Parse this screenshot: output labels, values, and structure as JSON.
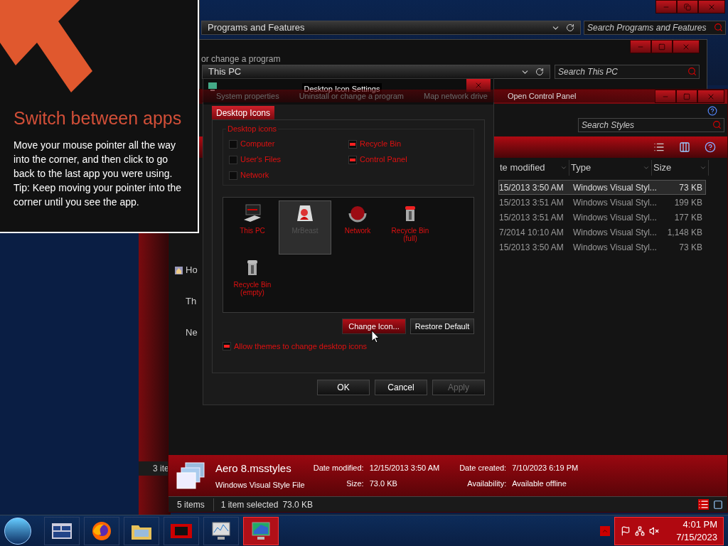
{
  "tip": {
    "title": "Switch between apps",
    "body": "Move your mouse pointer all the way into the corner, and then click to go back to the last app you were using.",
    "hint": "Tip: Keep moving your pointer into the corner until you see the app."
  },
  "programs_window": {
    "address": "Programs and Features",
    "search_placeholder": "Search Programs and Features"
  },
  "this_pc_window": {
    "heading_fragment": "or change a program",
    "address": "This PC",
    "search_placeholder": "Search This PC",
    "toolbar": [
      "System properties",
      "Uninstall or change a program",
      "Map network drive",
      "Open Control Panel"
    ]
  },
  "back_window": {
    "status_fragment": "3 ite"
  },
  "styles_window": {
    "search_placeholder": "Search Styles",
    "nav_fragments": [
      {
        "kind": "home",
        "label": "Ho"
      },
      {
        "kind": "none",
        "label": "Th"
      },
      {
        "kind": "none",
        "label": "Ne"
      }
    ],
    "columns": [
      "te modified",
      "Type",
      "Size"
    ],
    "rows": [
      {
        "date": "15/2013 3:50 AM",
        "type": "Windows Visual Styl...",
        "size": "73 KB",
        "selected": true
      },
      {
        "date": "15/2013 3:51 AM",
        "type": "Windows Visual Styl...",
        "size": "199 KB",
        "selected": false
      },
      {
        "date": "15/2013 3:51 AM",
        "type": "Windows Visual Styl...",
        "size": "177 KB",
        "selected": false
      },
      {
        "date": "7/2014 10:10 AM",
        "type": "Windows Visual Styl...",
        "size": "1,148 KB",
        "selected": false
      },
      {
        "date": "15/2013 3:50 AM",
        "type": "Windows Visual Styl...",
        "size": "73 KB",
        "selected": false
      }
    ],
    "details": {
      "name": "Aero 8.msstyles",
      "file_type": "Windows Visual Style File",
      "fields": [
        {
          "label": "Date modified:",
          "value": "12/15/2013 3:50 AM"
        },
        {
          "label": "Date created:",
          "value": "7/10/2023 6:19 PM"
        },
        {
          "label": "Size:",
          "value": "73.0 KB"
        },
        {
          "label": "Availability:",
          "value": "Available offline"
        }
      ]
    },
    "status": {
      "count": "5 items",
      "selection": "1 item selected",
      "size": "73.0 KB"
    }
  },
  "dialog": {
    "title": "Desktop Icon Settings",
    "tabs": [
      {
        "label": "Desktop Icons",
        "selected": true
      }
    ],
    "group_label": "Desktop icons",
    "checkboxes": [
      {
        "label": "Computer",
        "checked": false
      },
      {
        "label": "Recycle Bin",
        "checked": true
      },
      {
        "label": "User's Files",
        "checked": false
      },
      {
        "label": "Control Panel",
        "checked": true
      },
      {
        "label": "Network",
        "checked": false
      }
    ],
    "icons": [
      {
        "kind": "computer",
        "label": "This PC",
        "selected": false
      },
      {
        "kind": "user",
        "label": "MrBeast",
        "selected": true
      },
      {
        "kind": "network",
        "label": "Network",
        "selected": false
      },
      {
        "kind": "bin-full",
        "label": "Recycle Bin (full)",
        "selected": false
      },
      {
        "kind": "bin-empty",
        "label": "Recycle Bin (empty)",
        "selected": false
      }
    ],
    "change_button": "Change Icon...",
    "restore_button": "Restore Default",
    "allow_themes": {
      "label": "Allow themes to change desktop icons",
      "checked": true
    },
    "footer_buttons": [
      {
        "label": "OK",
        "disabled": false
      },
      {
        "label": "Cancel",
        "disabled": false
      },
      {
        "label": "Apply",
        "disabled": true
      }
    ]
  },
  "taskbar": {
    "apps": [
      {
        "kind": "explorer",
        "active": false
      },
      {
        "kind": "firefox",
        "active": false
      },
      {
        "kind": "folder",
        "active": false
      },
      {
        "kind": "card",
        "active": false
      },
      {
        "kind": "monitor-chart",
        "active": false
      },
      {
        "kind": "display",
        "active": true
      }
    ],
    "time": "4:01 PM",
    "date": "7/15/2023"
  }
}
